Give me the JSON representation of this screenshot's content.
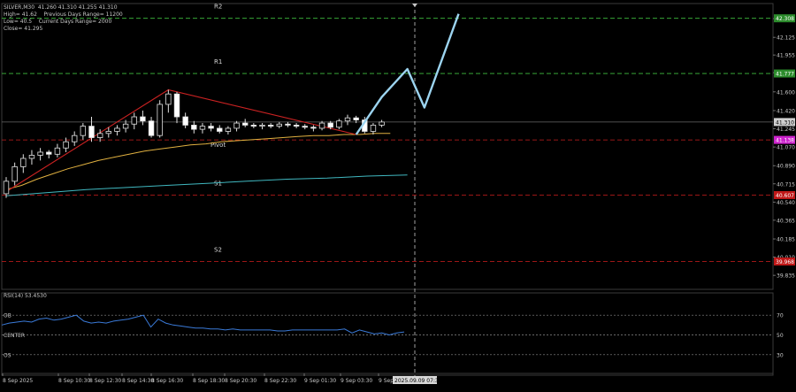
{
  "header": {
    "symbol_line": "SILVER,M30  41.260 41.310 41.255 41.310",
    "line2": "High= 41.62    Previous Days Range= 11200",
    "line3": "Low= 40.5    Current Days Range= 2000",
    "line4": "Close= 41.295"
  },
  "colors": {
    "background": "#000000",
    "grid": "#2a2a2a",
    "pivot_line": "#c81e1e",
    "r_line": "#3fbf3f",
    "s_line": "#d01e1e",
    "pivot_tag": "#cc22cc",
    "r_tag": "#2c8c2c",
    "s_tag": "#c01818",
    "price_tag": "#d0d0d0",
    "projection": "#9cd4f0",
    "ma_fast": "#e0b040",
    "ma_slow": "#40b8c0",
    "zigzag": "#cc2222",
    "rsi": "#3a7ad8",
    "candle_up": "#ffffff",
    "candle_down": "#ffffff",
    "candle_bull_body": "#000000"
  },
  "chart_data": {
    "type": "candlestick",
    "y_axis": {
      "min": 39.7,
      "max": 42.45,
      "ticks": [
        "42.305",
        "42.125",
        "41.955",
        "41.785",
        "41.600",
        "41.420",
        "41.245",
        "41.070",
        "40.890",
        "40.715",
        "40.540",
        "40.365",
        "40.185",
        "40.010",
        "39.835"
      ]
    },
    "levels": [
      {
        "label": "R2",
        "value": 42.308,
        "tag": "42.308",
        "kind": "r"
      },
      {
        "label": "R1",
        "value": 41.777,
        "tag": "41.777",
        "kind": "r"
      },
      {
        "label": "Pivot",
        "value": 41.138,
        "tag": "41.138",
        "kind": "pivot"
      },
      {
        "label": "S1",
        "value": 40.607,
        "tag": "40.607",
        "kind": "s"
      },
      {
        "label": "S2",
        "value": 39.968,
        "tag": "39.968",
        "kind": "s"
      }
    ],
    "current_price": {
      "value": 41.31,
      "tag": "41.310"
    },
    "x_axis": {
      "ticks": [
        "8 Sep 2025",
        "8 Sep 10:30",
        "8 Sep 12:30",
        "8 Sep 14:30",
        "8 Sep 16:30",
        "8 Sep 18:30",
        "8 Sep 20:30",
        "8 Sep 22:30",
        "9 Sep 01:30",
        "9 Sep 03:30",
        "9 Sep"
      ],
      "current_time_tag": "2025.09.09 07:30"
    },
    "candles": [
      [
        40.62,
        40.78,
        40.58,
        40.74
      ],
      [
        40.74,
        40.92,
        40.7,
        40.88
      ],
      [
        40.88,
        41.0,
        40.82,
        40.96
      ],
      [
        40.96,
        41.04,
        40.9,
        40.99
      ],
      [
        40.99,
        41.06,
        40.94,
        41.02
      ],
      [
        41.02,
        41.04,
        40.96,
        41.0
      ],
      [
        41.0,
        41.1,
        40.97,
        41.06
      ],
      [
        41.06,
        41.16,
        41.02,
        41.12
      ],
      [
        41.12,
        41.22,
        41.08,
        41.18
      ],
      [
        41.18,
        41.3,
        41.14,
        41.27
      ],
      [
        41.27,
        41.36,
        41.12,
        41.16
      ],
      [
        41.16,
        41.24,
        41.12,
        41.2
      ],
      [
        41.2,
        41.26,
        41.16,
        41.22
      ],
      [
        41.22,
        41.28,
        41.18,
        41.25
      ],
      [
        41.25,
        41.33,
        41.21,
        41.29
      ],
      [
        41.29,
        41.4,
        41.24,
        41.36
      ],
      [
        41.36,
        41.42,
        41.28,
        41.32
      ],
      [
        41.32,
        41.36,
        41.16,
        41.18
      ],
      [
        41.18,
        41.52,
        41.16,
        41.48
      ],
      [
        41.48,
        41.62,
        41.4,
        41.58
      ],
      [
        41.58,
        41.6,
        41.3,
        41.36
      ],
      [
        41.36,
        41.4,
        41.25,
        41.28
      ],
      [
        41.28,
        41.32,
        41.2,
        41.24
      ],
      [
        41.24,
        41.3,
        41.2,
        41.27
      ],
      [
        41.27,
        41.3,
        41.22,
        41.25
      ],
      [
        41.25,
        41.28,
        41.2,
        41.22
      ],
      [
        41.22,
        41.27,
        41.19,
        41.25
      ],
      [
        41.25,
        41.32,
        41.22,
        41.3
      ],
      [
        41.3,
        41.34,
        41.26,
        41.28
      ],
      [
        41.28,
        41.3,
        41.25,
        41.27
      ],
      [
        41.27,
        41.3,
        41.24,
        41.28
      ],
      [
        41.28,
        41.3,
        41.25,
        41.27
      ],
      [
        41.27,
        41.31,
        41.25,
        41.29
      ],
      [
        41.29,
        41.31,
        41.26,
        41.28
      ],
      [
        41.28,
        41.3,
        41.25,
        41.27
      ],
      [
        41.27,
        41.29,
        41.24,
        41.26
      ],
      [
        41.26,
        41.28,
        41.22,
        41.25
      ],
      [
        41.25,
        41.32,
        41.23,
        41.3
      ],
      [
        41.3,
        41.32,
        41.24,
        41.26
      ],
      [
        41.26,
        41.34,
        41.24,
        41.32
      ],
      [
        41.32,
        41.38,
        41.28,
        41.35
      ],
      [
        41.35,
        41.37,
        41.3,
        41.33
      ],
      [
        41.33,
        41.36,
        41.2,
        41.22
      ],
      [
        41.22,
        41.3,
        41.19,
        41.28
      ],
      [
        41.28,
        41.33,
        41.26,
        41.31
      ]
    ],
    "ma_fast": [
      40.66,
      40.7,
      40.76,
      40.81,
      40.86,
      40.9,
      40.94,
      40.97,
      41.0,
      41.03,
      41.05,
      41.07,
      41.09,
      41.1,
      41.12,
      41.13,
      41.14,
      41.15,
      41.16,
      41.17,
      41.18,
      41.18,
      41.19,
      41.19,
      41.2,
      41.2
    ],
    "ma_slow": [
      40.6,
      40.63,
      40.66,
      40.68,
      40.7,
      40.72,
      40.74,
      40.76,
      40.77,
      40.79,
      40.8
    ],
    "zigzag": [
      [
        0,
        40.64
      ],
      [
        19,
        41.62
      ],
      [
        41,
        41.19
      ]
    ],
    "projection": [
      [
        41,
        41.19
      ],
      [
        44,
        41.55
      ],
      [
        47,
        41.82
      ],
      [
        49,
        41.45
      ],
      [
        53,
        42.35
      ]
    ],
    "rsi": {
      "title": "RSI(14) 53.4530",
      "levels": [
        {
          "label": "OB",
          "value": 70
        },
        {
          "label": "CENTER",
          "value": 50
        },
        {
          "label": "OS",
          "value": 30
        }
      ],
      "ticks": [
        "70",
        "50",
        "30"
      ],
      "values": [
        60,
        62,
        63,
        64,
        63,
        66,
        67,
        65,
        66,
        68,
        70,
        64,
        62,
        63,
        62,
        64,
        65,
        66,
        68,
        70,
        58,
        66,
        62,
        60,
        59,
        58,
        57,
        57,
        56,
        56,
        55,
        56,
        55,
        55,
        55,
        55,
        55,
        54,
        54,
        55,
        55,
        55,
        55,
        55,
        55,
        55,
        56,
        52,
        55,
        53,
        51,
        52,
        50,
        52,
        53
      ]
    }
  }
}
